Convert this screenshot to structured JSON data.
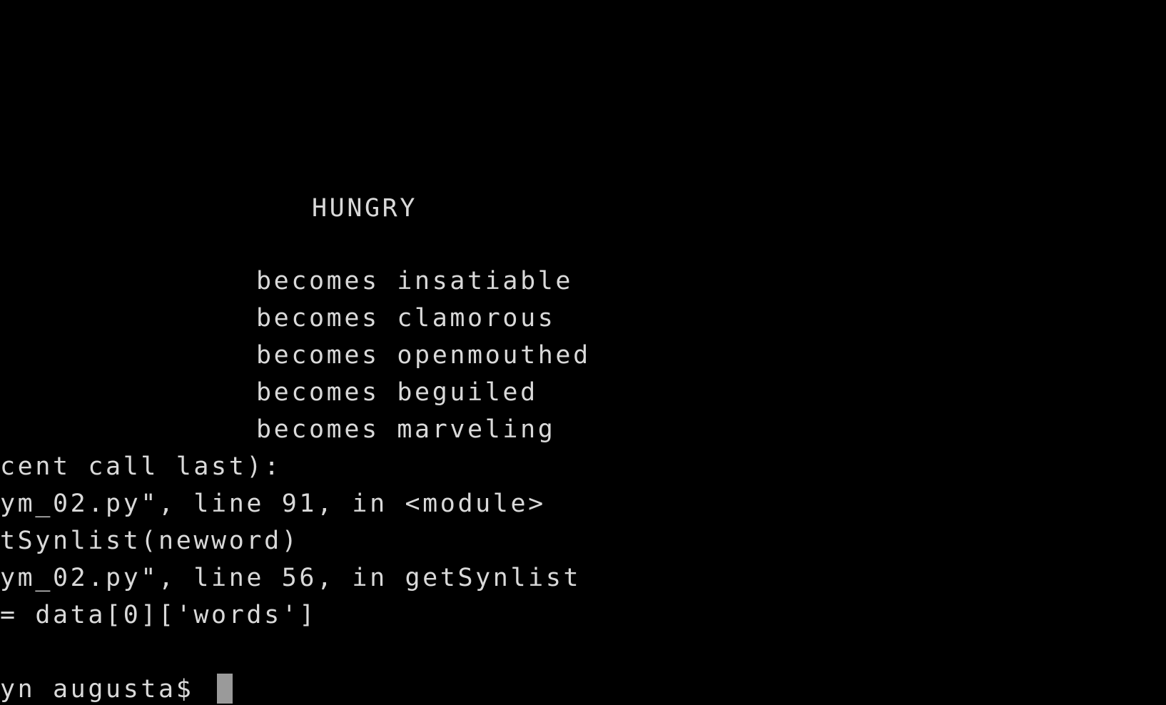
{
  "terminal": {
    "title": "HUNGRY",
    "synonyms": [
      "becomes insatiable",
      "becomes clamorous",
      "becomes openmouthed",
      "becomes beguiled",
      "becomes marveling"
    ],
    "traceback": [
      "cent call last):",
      "ym_02.py\", line 91, in <module>",
      "tSynlist(newword)",
      "ym_02.py\", line 56, in getSynlist",
      "= data[0]['words']"
    ],
    "prompt": "yn augusta$ "
  },
  "colors": {
    "background": "#000000",
    "text": "#d9d9d9",
    "cursor": "#9a9a9a"
  }
}
